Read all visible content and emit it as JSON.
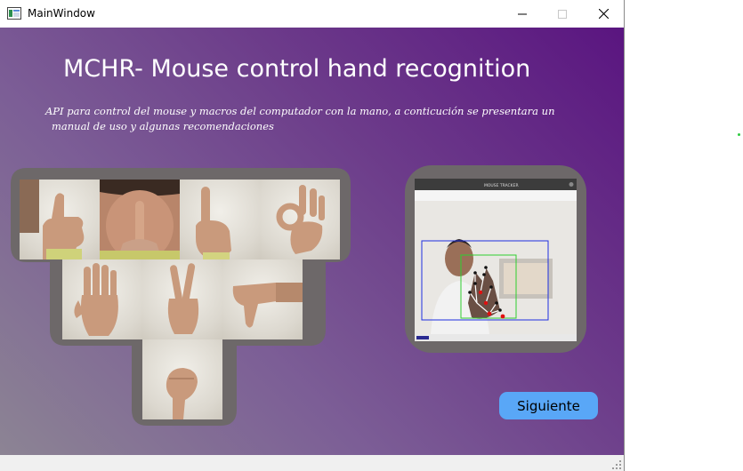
{
  "window": {
    "title": "MainWindow",
    "controls": [
      "minimize-icon",
      "maximize-icon",
      "close-icon"
    ]
  },
  "main": {
    "heading": "MCHR- Mouse control hand recognition",
    "subtitle_line1": "API para control del mouse y macros del computador con la mano, a conticución se presentara un",
    "subtitle_line2": "manual de uso y algunas recomendaciones"
  },
  "gestures": [
    {
      "name": "thumbs-up"
    },
    {
      "name": "finger-on-lips"
    },
    {
      "name": "index-up"
    },
    {
      "name": "ok-sign"
    },
    {
      "name": "open-palm"
    },
    {
      "name": "peace-sign"
    },
    {
      "name": "thumbs-down"
    },
    {
      "name": "fist"
    }
  ],
  "tracker": {
    "window_title": "MOUSE TRACKER",
    "colors": {
      "outer_box": "#1f2fe0",
      "inner_box": "#2fcf2f",
      "landmarks": "#e01010"
    }
  },
  "buttons": {
    "next_label": "Siguiente"
  },
  "colors": {
    "accent": "#59a7f7",
    "gradient_start": "#5a1580",
    "gradient_end": "#8c8494",
    "frame": "#6d6869"
  }
}
